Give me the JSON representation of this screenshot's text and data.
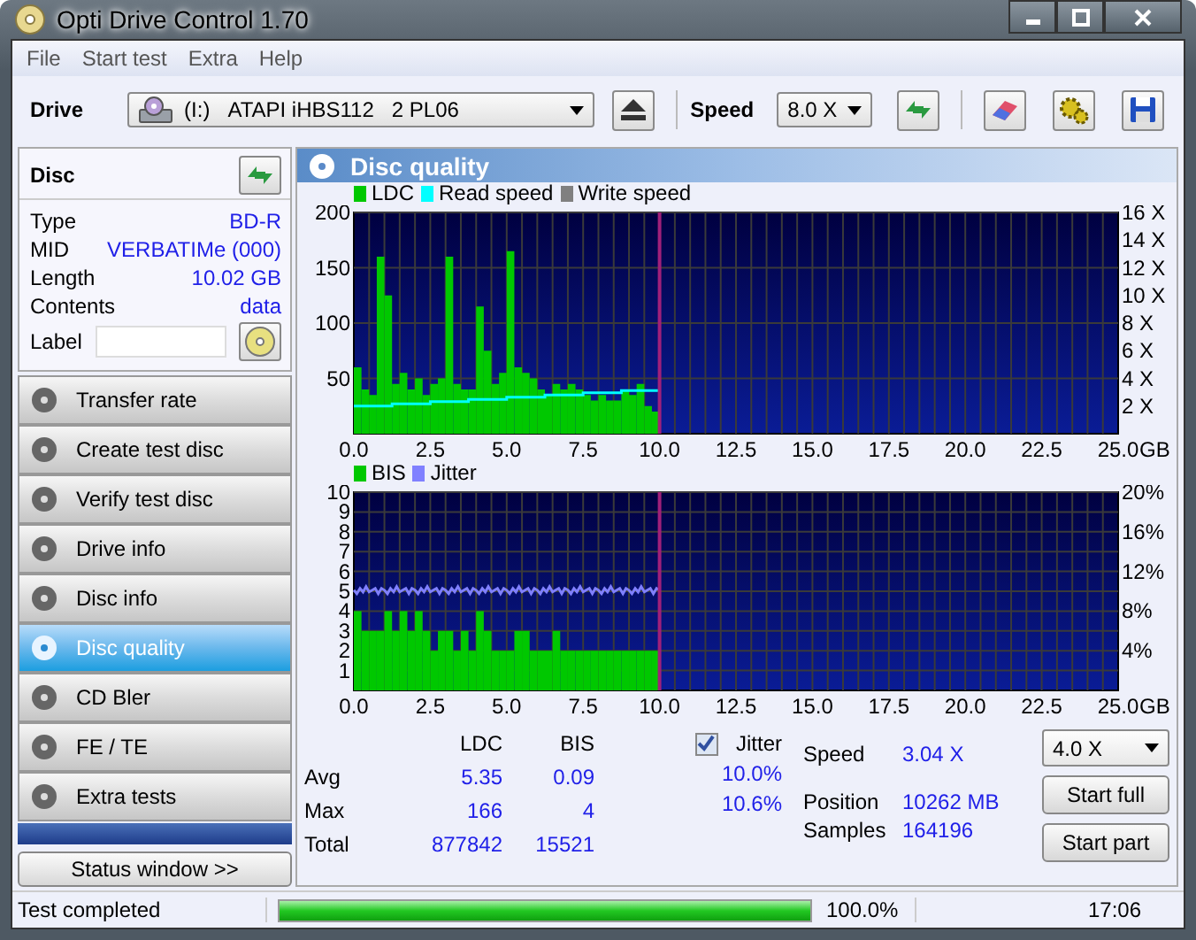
{
  "window": {
    "title": "Opti Drive Control 1.70"
  },
  "menu": [
    "File",
    "Start test",
    "Extra",
    "Help"
  ],
  "toolbar": {
    "drive_label": "Drive",
    "drive_letter": "(I:)",
    "drive_name": "ATAPI iHBS112   2 PL06",
    "speed_label": "Speed",
    "speed": "8.0 X"
  },
  "disc": {
    "title": "Disc",
    "info": [
      {
        "label": "Type",
        "value": "BD-R"
      },
      {
        "label": "MID",
        "value": "VERBATIMe (000)"
      },
      {
        "label": "Length",
        "value": "10.02 GB"
      },
      {
        "label": "Contents",
        "value": "data"
      }
    ],
    "label_field": "Label"
  },
  "nav": [
    {
      "label": "Transfer rate",
      "selected": false
    },
    {
      "label": "Create test disc",
      "selected": false
    },
    {
      "label": "Verify test disc",
      "selected": false
    },
    {
      "label": "Drive info",
      "selected": false
    },
    {
      "label": "Disc info",
      "selected": false
    },
    {
      "label": "Disc quality",
      "selected": true
    },
    {
      "label": "CD Bler",
      "selected": false
    },
    {
      "label": "FE / TE",
      "selected": false
    },
    {
      "label": "Extra tests",
      "selected": false
    }
  ],
  "status_window_button": "Status window >>",
  "panel": {
    "title": "Disc quality",
    "charts": [
      {
        "legend": [
          {
            "label": "Read speed",
            "color": "#00ffff"
          },
          {
            "label": "Write speed",
            "color": "#808080"
          }
        ],
        "chart_data": {
          "type": "bar",
          "grid": true,
          "ref_lines": [
            {
              "axis": "x",
              "value": 10,
              "color": "#a0207a"
            }
          ],
          "xlabel": "GB",
          "xlim": [
            0,
            25
          ],
          "ylim": [
            0,
            200
          ],
          "y2lim": [
            0,
            16
          ],
          "xticks": [
            {
              "value": 0,
              "label": "0.0"
            },
            {
              "value": 2.5,
              "label": "2.5"
            },
            {
              "value": 5,
              "label": "5.0"
            },
            {
              "value": 7.5,
              "label": "7.5"
            },
            {
              "value": 10,
              "label": "10.0"
            },
            {
              "value": 12.5,
              "label": "12.5"
            },
            {
              "value": 15,
              "label": "15.0"
            },
            {
              "value": 17.5,
              "label": "17.5"
            },
            {
              "value": 20,
              "label": "20.0"
            },
            {
              "value": 22.5,
              "label": "22.5"
            },
            {
              "value": 25,
              "label": "25.0"
            }
          ],
          "yticks": [
            50,
            100,
            150,
            200
          ],
          "y2ticks": [
            {
              "value": 2,
              "label": "2 X"
            },
            {
              "value": 4,
              "label": "4 X"
            },
            {
              "value": 6,
              "label": "6 X"
            },
            {
              "value": 8,
              "label": "8 X"
            },
            {
              "value": 10,
              "label": "10 X"
            },
            {
              "value": 12,
              "label": "12 X"
            },
            {
              "value": 14,
              "label": "14 X"
            },
            {
              "value": 16,
              "label": "16 X"
            }
          ],
          "x": [
            0.25,
            0.5,
            0.75,
            1,
            1.25,
            1.5,
            1.75,
            2,
            2.25,
            2.5,
            2.75,
            3,
            3.25,
            3.5,
            3.75,
            4,
            4.25,
            4.5,
            4.75,
            5,
            5.25,
            5.5,
            5.75,
            6,
            6.25,
            6.5,
            6.75,
            7,
            7.25,
            7.5,
            7.75,
            8,
            8.25,
            8.5,
            8.75,
            9,
            9.25,
            9.5,
            9.75,
            10
          ],
          "series": [
            {
              "name": "LDC",
              "color": "#00c800",
              "values": [
                60,
                40,
                35,
                160,
                125,
                45,
                55,
                40,
                50,
                35,
                45,
                50,
                160,
                45,
                40,
                40,
                115,
                75,
                45,
                55,
                165,
                60,
                55,
                50,
                40,
                35,
                45,
                40,
                45,
                40,
                35,
                30,
                35,
                30,
                30,
                40,
                35,
                45,
                25,
                20
              ]
            }
          ]
        }
      },
      {
        "legend": [
          {
            "label": "Jitter",
            "color": "#8080ff"
          }
        ],
        "chart_data": {
          "type": "bar",
          "grid": true,
          "ref_lines": [
            {
              "axis": "x",
              "value": 10,
              "color": "#a0207a"
            }
          ],
          "xlabel": "GB",
          "xlim": [
            0,
            25
          ],
          "ylim": [
            0,
            10
          ],
          "y2lim": [
            0,
            20
          ],
          "xticks": [
            {
              "value": 0,
              "label": "0.0"
            },
            {
              "value": 2.5,
              "label": "2.5"
            },
            {
              "value": 5,
              "label": "5.0"
            },
            {
              "value": 7.5,
              "label": "7.5"
            },
            {
              "value": 10,
              "label": "10.0"
            },
            {
              "value": 12.5,
              "label": "12.5"
            },
            {
              "value": 15,
              "label": "15.0"
            },
            {
              "value": 17.5,
              "label": "17.5"
            },
            {
              "value": 20,
              "label": "20.0"
            },
            {
              "value": 22.5,
              "label": "22.5"
            },
            {
              "value": 25,
              "label": "25.0"
            }
          ],
          "yticks": [
            1,
            2,
            3,
            4,
            5,
            6,
            7,
            8,
            9,
            10
          ],
          "y2ticks": [
            {
              "value": 4,
              "label": "4%"
            },
            {
              "value": 8,
              "label": "8%"
            },
            {
              "value": 12,
              "label": "12%"
            },
            {
              "value": 16,
              "label": "16%"
            },
            {
              "value": 20,
              "label": "20%"
            }
          ],
          "x": [
            0.25,
            0.5,
            0.75,
            1,
            1.25,
            1.5,
            1.75,
            2,
            2.25,
            2.5,
            2.75,
            3,
            3.25,
            3.5,
            3.75,
            4,
            4.25,
            4.5,
            4.75,
            5,
            5.25,
            5.5,
            5.75,
            6,
            6.25,
            6.5,
            6.75,
            7,
            7.25,
            7.5,
            7.75,
            8,
            8.25,
            8.5,
            8.75,
            9,
            9.25,
            9.5,
            9.75,
            10
          ],
          "series": [
            {
              "name": "BIS",
              "color": "#00c800",
              "values": [
                4,
                3,
                3,
                3,
                4,
                3,
                4,
                3,
                4,
                3,
                2,
                3,
                3,
                2,
                3,
                2,
                4,
                3,
                2,
                2,
                2,
                3,
                3,
                2,
                2,
                2,
                3,
                2,
                2,
                2,
                2,
                2,
                2,
                2,
                2,
                2,
                2,
                2,
                2,
                2
              ]
            }
          ]
        }
      }
    ]
  },
  "results": {
    "headers": [
      "LDC",
      "BIS"
    ],
    "jitter": {
      "label": "Jitter",
      "checked": true
    },
    "rows": [
      {
        "label": "Avg",
        "values": [
          "5.35",
          "0.09"
        ],
        "jitter": "10.0%"
      },
      {
        "label": "Max",
        "values": [
          "166",
          "4"
        ],
        "jitter": "10.6%"
      },
      {
        "label": "Total",
        "values": [
          "877842",
          "15521"
        ]
      }
    ],
    "readout": [
      {
        "label": "Speed",
        "value": "3.04 X"
      },
      {
        "label": "Position",
        "value": "10262 MB"
      },
      {
        "label": "Samples",
        "value": "164196"
      }
    ],
    "speed_select": "4.0 X",
    "buttons": [
      "Start full",
      "Start part"
    ]
  },
  "status_bar": {
    "message": "Test completed",
    "progress": {
      "level": 1.0
    },
    "percent": "100.0%",
    "time": "17:06"
  }
}
